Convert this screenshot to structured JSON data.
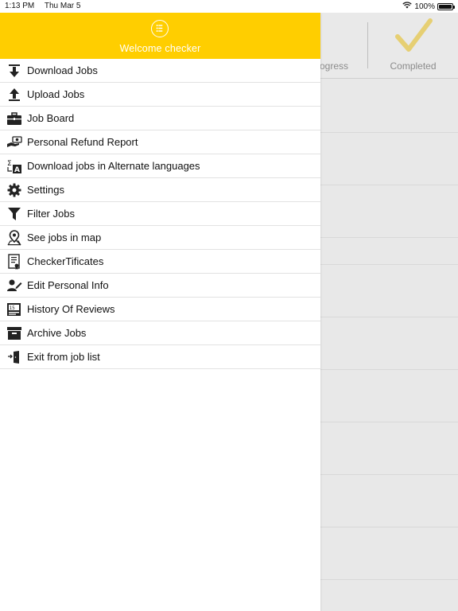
{
  "status_bar": {
    "time": "1:13 PM",
    "date": "Thu Mar 5",
    "battery": "100%"
  },
  "drawer": {
    "header_title": "Welcome  checker",
    "accent_color": "#ffce00",
    "items": [
      {
        "label": "Download Jobs",
        "icon": "download-icon"
      },
      {
        "label": "Upload Jobs",
        "icon": "upload-icon"
      },
      {
        "label": "Job Board",
        "icon": "briefcase-icon"
      },
      {
        "label": "Personal Refund Report",
        "icon": "refund-icon"
      },
      {
        "label": "Download jobs in Alternate languages",
        "icon": "translate-icon"
      },
      {
        "label": "Settings",
        "icon": "gear-icon"
      },
      {
        "label": "Filter Jobs",
        "icon": "filter-icon"
      },
      {
        "label": "See jobs in map",
        "icon": "map-pin-icon"
      },
      {
        "label": "CheckerTificates",
        "icon": "certificate-icon"
      },
      {
        "label": "Edit Personal Info",
        "icon": "edit-person-icon"
      },
      {
        "label": "History Of Reviews",
        "icon": "history-icon"
      },
      {
        "label": "Archive Jobs",
        "icon": "archive-icon"
      },
      {
        "label": "Exit from job list",
        "icon": "exit-icon"
      }
    ]
  },
  "background": {
    "tab_progress_label": "ogress",
    "tab_completed_label": "Completed"
  }
}
